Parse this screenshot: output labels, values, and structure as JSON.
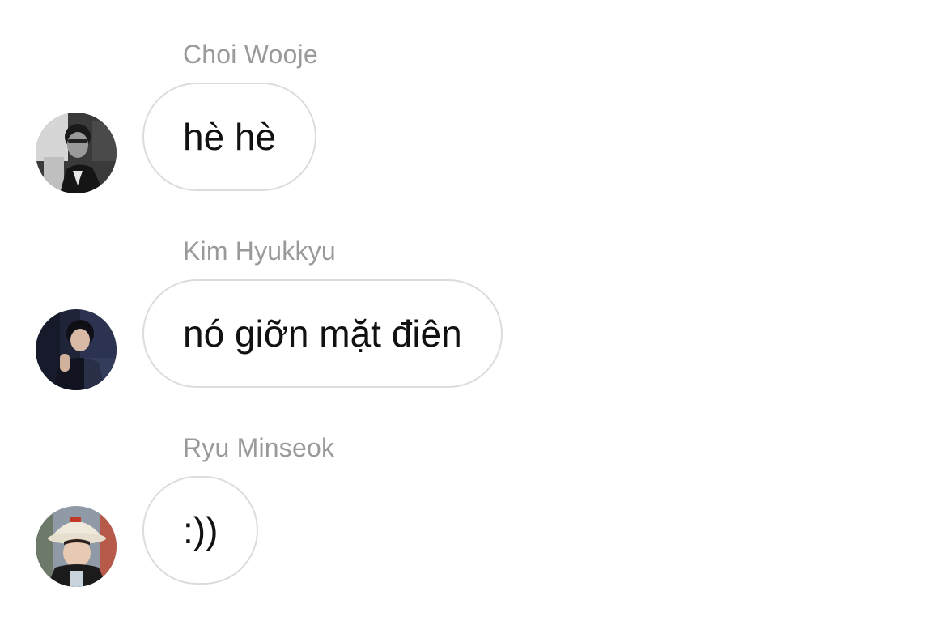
{
  "messages": [
    {
      "sender": "Choi Wooje",
      "text": "hè hè",
      "avatar_icon": "profile-photo-grayscale"
    },
    {
      "sender": "Kim Hyukkyu",
      "text": "nó giỡn mặt điên",
      "avatar_icon": "profile-photo-dark-suit"
    },
    {
      "sender": "Ryu Minseok",
      "text": ":))",
      "avatar_icon": "profile-photo-bucket-hat"
    }
  ],
  "colors": {
    "sender_name": "#9a9a9a",
    "bubble_border": "#dcdcdc",
    "message_text": "#111111"
  }
}
